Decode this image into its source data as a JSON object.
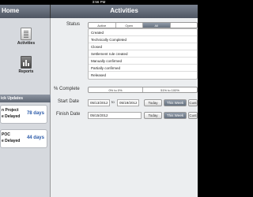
{
  "status_bar": {
    "time": "3:56 PM"
  },
  "left_header": {
    "title": "Home"
  },
  "right_header": {
    "title": "Activities"
  },
  "sidebar": {
    "items": [
      {
        "label": "Activities",
        "icon": "checklist-icon"
      },
      {
        "label": "Reports",
        "icon": "bar-chart-icon"
      }
    ],
    "quick_updates": {
      "title": "ick Updates",
      "cards": [
        {
          "line1": "n Project",
          "line2": "e Delayed",
          "days": "78 days"
        },
        {
          "line1": "POC",
          "line2": "e Delayed",
          "days": "44 days"
        }
      ]
    }
  },
  "form": {
    "status_label": "Status",
    "status_tabs": [
      {
        "label": "Active",
        "selected": false
      },
      {
        "label": "Open",
        "selected": false
      },
      {
        "label": "All",
        "selected": true
      },
      {
        "label": "",
        "selected": false
      }
    ],
    "status_options": [
      "Created",
      "Technically Completed",
      "Closed",
      "Settlement rule created",
      "Manually confirmed",
      "Partially confirmed",
      "Released"
    ],
    "percent_label": "% Complete",
    "percent_tabs": [
      {
        "label": "0% to 0%",
        "selected": false
      },
      {
        "label": "51% to 100%",
        "selected": false
      }
    ],
    "start_date_label": "Start Date",
    "start_from": "05/13/2012",
    "to_label": "to",
    "start_to": "05/19/2012",
    "finish_date_label": "Finish Date",
    "finish_date": "05/15/2012",
    "today_label": "Today",
    "this_week_label": "This Week",
    "custom_label": "Cust"
  }
}
